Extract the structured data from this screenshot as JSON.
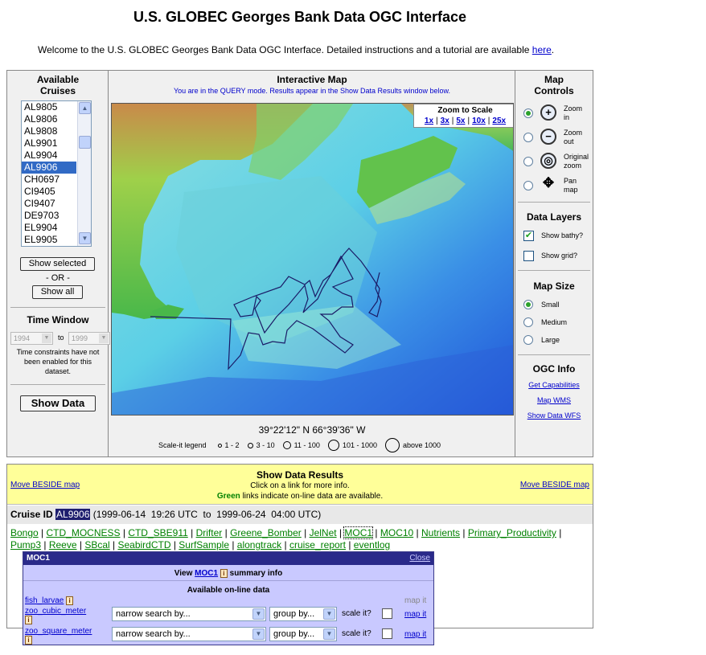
{
  "page_title": "U.S. GLOBEC Georges Bank Data OGC Interface",
  "welcome": {
    "text": "Welcome to the U.S. GLOBEC Georges Bank Data OGC Interface. Detailed instructions and a tutorial are available",
    "link": "here",
    "end": "."
  },
  "cruises": {
    "title_line1": "Available",
    "title_line2": "Cruises",
    "items": [
      "AL9805",
      "AL9806",
      "AL9808",
      "AL9901",
      "AL9904",
      "AL9906",
      "CH0697",
      "CI9405",
      "CI9407",
      "DE9703",
      "EL9904",
      "EL9905"
    ],
    "selected": "AL9906",
    "show_selected": "Show selected",
    "or": "- OR -",
    "show_all": "Show all"
  },
  "time_window": {
    "title": "Time Window",
    "from": "1994",
    "to_label": "to",
    "to": "1999",
    "note": "Time constraints have not been enabled for this dataset."
  },
  "show_data": "Show Data",
  "map": {
    "title": "Interactive Map",
    "subtitle": "You are in the QUERY mode. Results appear in the Show Data Results window below.",
    "zoom_title": "Zoom to Scale",
    "zoom_options": [
      "1x",
      "3x",
      "5x",
      "10x",
      "25x"
    ],
    "coords": "39°22'12\" N 66°39'36\" W",
    "scale_legend": "Scale-it legend",
    "scale_items": [
      "1 - 2",
      "3 - 10",
      "11 - 100",
      "101 - 1000",
      "above 1000"
    ]
  },
  "map_controls": {
    "title_line1": "Map",
    "title_line2": "Controls",
    "options": [
      {
        "l1": "Zoom",
        "l2": "in",
        "selected": true
      },
      {
        "l1": "Zoom",
        "l2": "out",
        "selected": false
      },
      {
        "l1": "Original",
        "l2": "zoom",
        "selected": false
      },
      {
        "l1": "Pan",
        "l2": "map",
        "selected": false
      }
    ]
  },
  "data_layers": {
    "title": "Data Layers",
    "bathy": "Show bathy?",
    "bathy_checked": true,
    "grid": "Show grid?",
    "grid_checked": false
  },
  "map_size": {
    "title": "Map Size",
    "options": [
      "Small",
      "Medium",
      "Large"
    ],
    "selected": "Small"
  },
  "ogc_info": {
    "title": "OGC Info",
    "links": [
      "Get Capabilities",
      "Map WMS",
      "Show Data WFS"
    ]
  },
  "results": {
    "title": "Show Data Results",
    "line1": "Click on a link for more info.",
    "line2_green": "Green",
    "line2_rest": "links indicate on-line data are available.",
    "move_left": "Move BESIDE map",
    "move_right": "Move BESIDE map",
    "cruise_label": "Cruise ID",
    "cruise_id": "AL9906",
    "cruise_dates": "(1999-06-14  19:26 UTC  to  1999-06-24  04:00 UTC)",
    "datasets": [
      {
        "name": "Bongo",
        "online": true
      },
      {
        "name": "CTD_MOCNESS",
        "online": true
      },
      {
        "name": "CTD_SBE911",
        "online": true
      },
      {
        "name": "Drifter",
        "online": true
      },
      {
        "name": "Greene_Bomber",
        "online": true
      },
      {
        "name": "JelNet",
        "online": true
      },
      {
        "name": "MOC1",
        "online": true
      },
      {
        "name": "MOC10",
        "online": true
      },
      {
        "name": "Nutrients",
        "online": true
      },
      {
        "name": "Primary_Productivity",
        "online": true
      },
      {
        "name": "Pump3",
        "online": true
      },
      {
        "name": "Reeve",
        "online": true
      },
      {
        "name": "SBcal",
        "online": true
      },
      {
        "name": "SeabirdCTD",
        "online": true
      },
      {
        "name": "SurfSample",
        "online": true
      },
      {
        "name": "alongtrack",
        "online": true
      },
      {
        "name": "cruise_report",
        "online": true
      },
      {
        "name": "eventlog",
        "online": true
      }
    ]
  },
  "popup": {
    "title": "MOC1",
    "close": "Close",
    "view_pre": "View",
    "view_link": "MOC1",
    "view_post": "summary info",
    "available": "Available on-line data",
    "rows": [
      {
        "name": "fish_larvae",
        "has_controls": false,
        "map_it": "map it",
        "map_enabled": false
      },
      {
        "name": "zoo_cubic_meter",
        "has_controls": true,
        "narrow": "narrow search by...",
        "group": "group by...",
        "scale": "scale it?",
        "map_it": "map it",
        "map_enabled": true
      },
      {
        "name": "zoo_square_meter",
        "has_controls": true,
        "narrow": "narrow search by...",
        "group": "group by...",
        "scale": "scale it?",
        "map_it": "map it",
        "map_enabled": true
      }
    ]
  },
  "colors": {
    "accent": "#0000cc",
    "online": "#008000",
    "popup_bar": "#2a2a8a",
    "popup_bg": "#c9c9ff",
    "results_head": "#ffff99"
  }
}
